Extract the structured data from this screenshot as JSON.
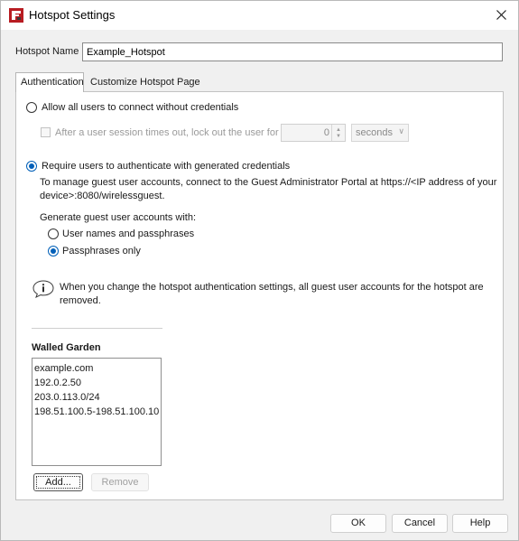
{
  "window": {
    "title": "Hotspot Settings",
    "app_icon": "firebox-app-icon",
    "close_icon": "close-icon"
  },
  "hotspot_name": {
    "label": "Hotspot Name",
    "value": "Example_Hotspot"
  },
  "tabs": [
    {
      "label": "Authentication",
      "active": true
    },
    {
      "label": "Customize Hotspot Page",
      "active": false
    }
  ],
  "auth": {
    "allow_all": {
      "label": "Allow all users to connect without credentials",
      "selected": false
    },
    "lockout": {
      "label": "After a user session times out, lock out the user for",
      "checked": false,
      "value": "0",
      "unit": "seconds"
    },
    "require_credentials": {
      "label": "Require users to authenticate with generated credentials",
      "selected": true
    },
    "manage_note_line1": "To manage guest user accounts, connect to the Guest Administrator Portal at https://<IP address of your",
    "manage_note_line2": "device>:8080/wirelessguest.",
    "generate_label": "Generate guest user accounts with:",
    "generate_options": [
      {
        "label": "User names and passphrases",
        "selected": false
      },
      {
        "label": "Passphrases only",
        "selected": true
      }
    ],
    "info_line1": "When you change the hotspot authentication settings, all guest user accounts for the hotspot are",
    "info_line2": "removed."
  },
  "walled_garden": {
    "title": "Walled Garden",
    "items": [
      "example.com",
      "192.0.2.50",
      "203.0.113.0/24",
      "198.51.100.5-198.51.100.10"
    ],
    "add_label": "Add...",
    "remove_label": "Remove"
  },
  "footer": {
    "ok_label": "OK",
    "cancel_label": "Cancel",
    "help_label": "Help"
  },
  "colors": {
    "accent": "#005fb8",
    "panel": "#ffffff",
    "dialog_bg": "#f0f0f0"
  }
}
